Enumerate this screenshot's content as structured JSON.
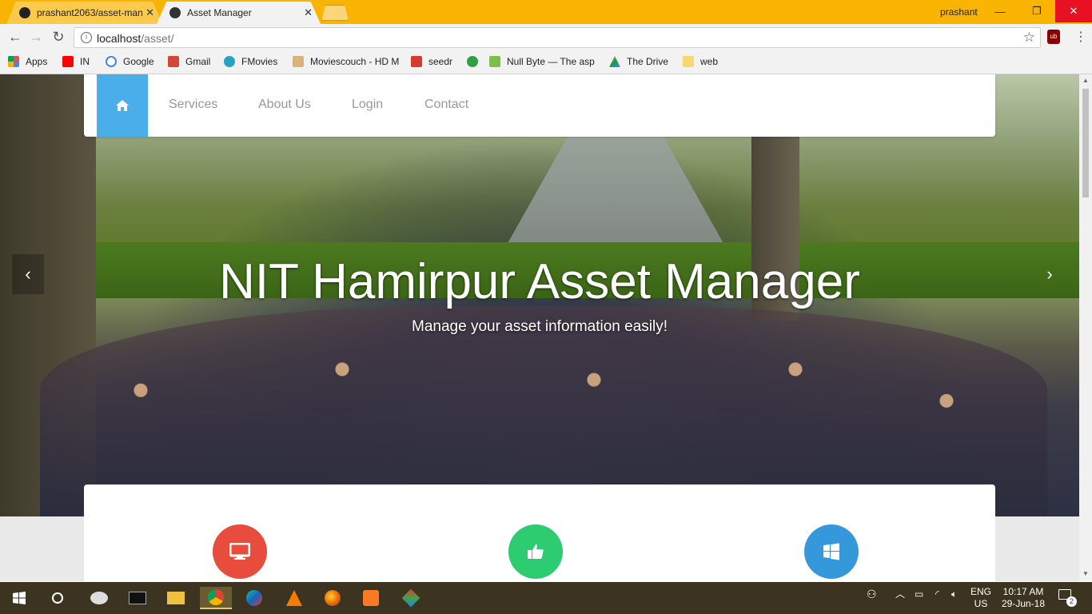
{
  "browser": {
    "tabs": [
      {
        "title": "prashant2063/asset-man",
        "active": false
      },
      {
        "title": "Asset Manager",
        "active": true
      }
    ],
    "profile_name": "prashant",
    "window_controls": {
      "minimize": "—",
      "restore": "❐",
      "close": "✕"
    },
    "url_host": "localhost",
    "url_path": "/asset/",
    "extension_label": "ub",
    "bookmarks": [
      {
        "label": "Apps",
        "color": "#e05252"
      },
      {
        "label": "IN",
        "color": "#ff0000"
      },
      {
        "label": "Google",
        "color": "#4285f4"
      },
      {
        "label": "Gmail",
        "color": "#d44638"
      },
      {
        "label": "FMovies",
        "color": "#25a3c5"
      },
      {
        "label": "Moviescouch - HD M",
        "color": "#d9b47a"
      },
      {
        "label": "seedr",
        "color": "#d63a2f"
      },
      {
        "label": "Null Byte — The asp",
        "color": "#2ea043"
      },
      {
        "label": "The Drive",
        "color": "#f4b400"
      },
      {
        "label": "web",
        "color": "#f7d774"
      }
    ]
  },
  "navbar": {
    "home_icon": "home-icon",
    "links": [
      "Services",
      "About Us",
      "Login",
      "Contact"
    ]
  },
  "hero": {
    "title": "NIT Hamirpur Asset Manager",
    "subtitle": "Manage your asset information easily!",
    "prev_label": "‹",
    "next_label": "›"
  },
  "features": [
    {
      "icon": "desktop-icon",
      "color": "#e74c3c"
    },
    {
      "icon": "thumbs-up-icon",
      "color": "#2ecc71"
    },
    {
      "icon": "windows-icon",
      "color": "#3498db"
    }
  ],
  "taskbar": {
    "language": "ENG",
    "region": "US",
    "time": "10:17 AM",
    "date": "29-Jun-18",
    "notification_count": "2"
  },
  "colors": {
    "chrome_title": "#f8b400",
    "home_button": "#4aaee8",
    "taskbar": "#3c3420"
  }
}
